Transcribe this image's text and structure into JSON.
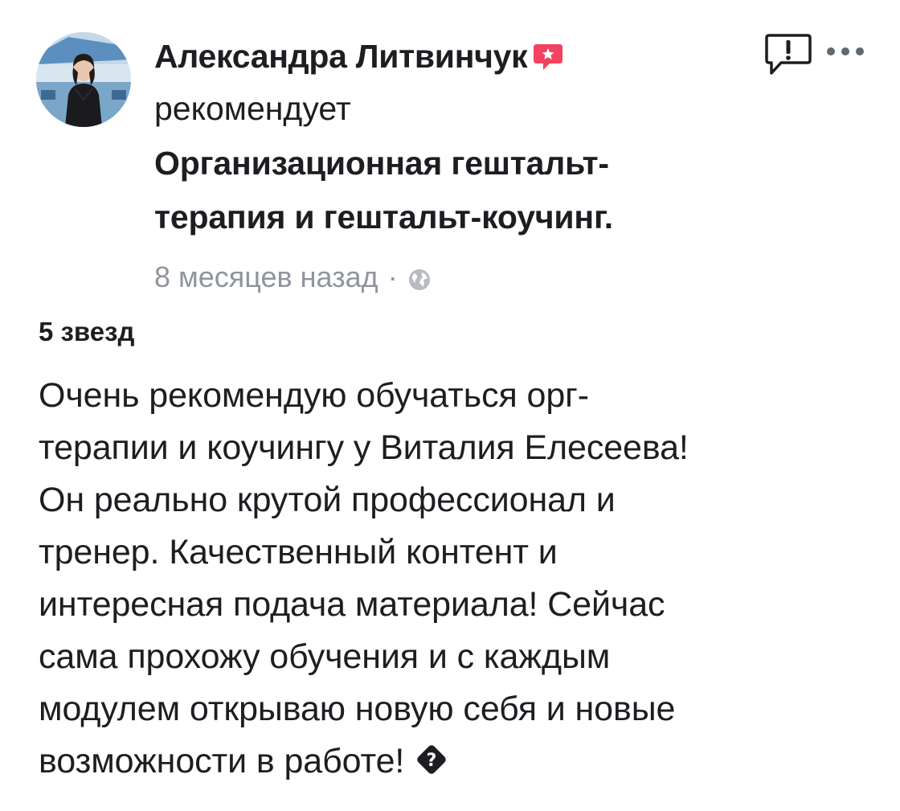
{
  "post": {
    "author": {
      "name": "Александра Литвинчук",
      "avatar_icon": "user-avatar-photo",
      "recommend_icon": "recommendation-badge-icon",
      "recommend_color": "#f3425f"
    },
    "action": "рекомендует",
    "page_name_lines": [
      "Организационная гештальт-",
      "терапия и гештальт-коучинг."
    ],
    "meta": {
      "time": "8 месяцев назад",
      "separator": "·",
      "privacy_icon": "globe-icon"
    },
    "header_actions": {
      "report_icon": "report-icon",
      "more_icon": "more-options-icon"
    },
    "rating": "5 звезд",
    "review_lines": [
      "Очень рекомендую обучаться орг-",
      "терапии и коучингу у Виталия Елесеева!",
      "Он реально крутой профессионал и",
      "тренер. Качественный контент и",
      "интересная подача материала! Сейчас",
      "сама прохожу обучения и с каждым",
      "модулем открываю новую себя и новые",
      "возможности в работе!"
    ],
    "review_end_icon": "diamond-emoji-icon",
    "colors": {
      "text": "#1c1e21",
      "meta": "#90949c",
      "background": "#ffffff"
    }
  }
}
